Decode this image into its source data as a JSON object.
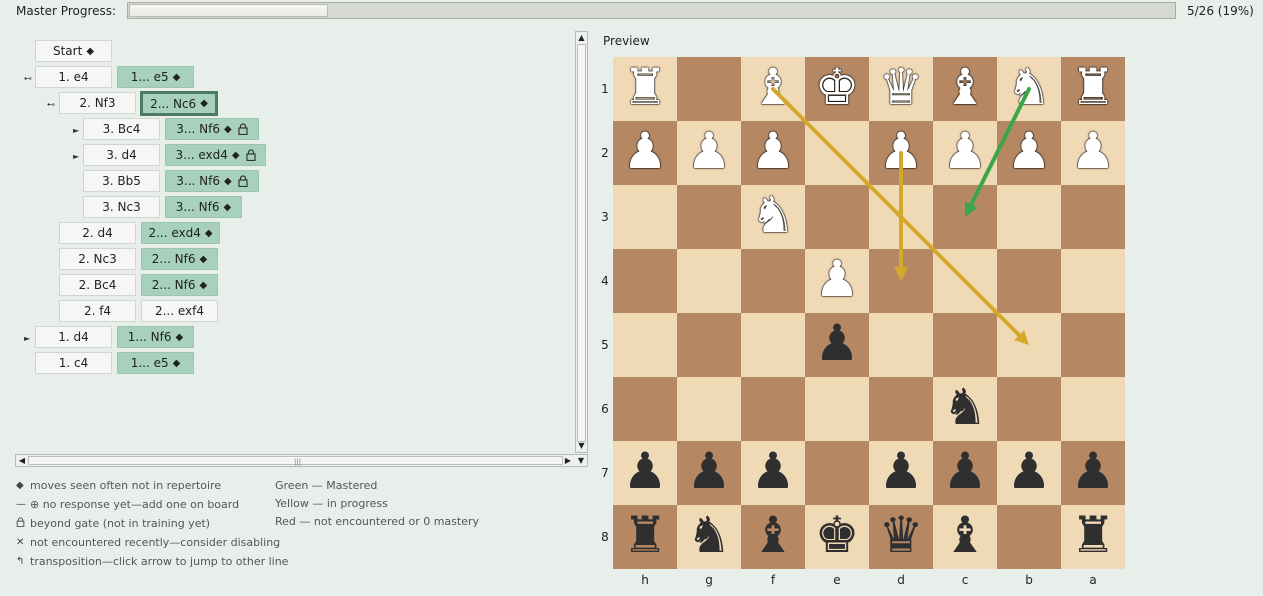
{
  "master_progress": {
    "label": "Master Progress:",
    "value": 0.19,
    "count_text": "5/26 (19%)"
  },
  "tree": {
    "nodes": [
      {
        "id": "start",
        "label": "Start",
        "green": true,
        "diamond": true
      },
      {
        "id": "e4",
        "label": "1. e4"
      },
      {
        "id": "e5",
        "label": "1... e5",
        "green": true,
        "diamond": true
      },
      {
        "id": "nf3",
        "label": "2. Nf3"
      },
      {
        "id": "nc6",
        "label": "2... Nc6",
        "green": true,
        "diamond": true,
        "selected": true
      },
      {
        "id": "bc4",
        "label": "3. Bc4"
      },
      {
        "id": "nf6a",
        "label": "3... Nf6",
        "green": true,
        "diamond": true,
        "lock": true
      },
      {
        "id": "d4",
        "label": "3. d4"
      },
      {
        "id": "exd4a",
        "label": "3... exd4",
        "green": true,
        "diamond": true,
        "lock": true
      },
      {
        "id": "bb5",
        "label": "3. Bb5"
      },
      {
        "id": "nf6b",
        "label": "3... Nf6",
        "green": true,
        "diamond": true,
        "lock": true
      },
      {
        "id": "nc3a",
        "label": "3. Nc3"
      },
      {
        "id": "nf6c",
        "label": "3... Nf6",
        "green": true,
        "diamond": true
      },
      {
        "id": "d4b",
        "label": "2. d4"
      },
      {
        "id": "exd4b",
        "label": "2... exd4",
        "green": true,
        "diamond": true
      },
      {
        "id": "nc3b",
        "label": "2. Nc3"
      },
      {
        "id": "nf6d",
        "label": "2... Nf6",
        "green": true,
        "diamond": true
      },
      {
        "id": "bc4b",
        "label": "2. Bc4"
      },
      {
        "id": "nf6e",
        "label": "2... Nf6",
        "green": true,
        "diamond": true
      },
      {
        "id": "f4",
        "label": "2. f4"
      },
      {
        "id": "exf4",
        "label": "2... exf4"
      },
      {
        "id": "d4c",
        "label": "1. d4"
      },
      {
        "id": "nf6f",
        "label": "1... Nf6",
        "green": true,
        "diamond": true
      },
      {
        "id": "c4",
        "label": "1. c4"
      },
      {
        "id": "e5b",
        "label": "1... e5",
        "green": true,
        "diamond": true
      }
    ]
  },
  "legend": {
    "left": [
      {
        "glyph": "◆",
        "text": "moves seen often not in repertoire"
      },
      {
        "glyph": "—",
        "text": "⊕  no response yet—add one on board"
      },
      {
        "glyph": "🔒",
        "text": "beyond gate (not in training yet)"
      },
      {
        "glyph": "✕",
        "text": "not encountered recently—consider disabling"
      },
      {
        "glyph": "↰",
        "text": "transposition—click arrow to jump to other line"
      }
    ],
    "right": [
      "Green — Mastered",
      "Yellow — in progress",
      "Red — not encountered or 0 mastery"
    ]
  },
  "preview": {
    "title": "Preview",
    "files": [
      "h",
      "g",
      "f",
      "e",
      "d",
      "c",
      "b",
      "a"
    ],
    "ranks": [
      "1",
      "2",
      "3",
      "4",
      "5",
      "6",
      "7",
      "8"
    ],
    "pieces": [
      {
        "sq": "h1",
        "glyph": "♜",
        "color": "w"
      },
      {
        "sq": "f1",
        "glyph": "♝",
        "color": "w"
      },
      {
        "sq": "e1",
        "glyph": "♚",
        "color": "w"
      },
      {
        "sq": "d1",
        "glyph": "♛",
        "color": "w"
      },
      {
        "sq": "c1",
        "glyph": "♝",
        "color": "w"
      },
      {
        "sq": "b1",
        "glyph": "♞",
        "color": "w"
      },
      {
        "sq": "a1",
        "glyph": "♜",
        "color": "w"
      },
      {
        "sq": "h2",
        "glyph": "♟",
        "color": "w"
      },
      {
        "sq": "g2",
        "glyph": "♟",
        "color": "w"
      },
      {
        "sq": "f2",
        "glyph": "♟",
        "color": "w"
      },
      {
        "sq": "d2",
        "glyph": "♟",
        "color": "w"
      },
      {
        "sq": "c2",
        "glyph": "♟",
        "color": "w"
      },
      {
        "sq": "b2",
        "glyph": "♟",
        "color": "w"
      },
      {
        "sq": "a2",
        "glyph": "♟",
        "color": "w"
      },
      {
        "sq": "f3",
        "glyph": "♞",
        "color": "w"
      },
      {
        "sq": "e4",
        "glyph": "♟",
        "color": "w"
      },
      {
        "sq": "e5",
        "glyph": "♟",
        "color": "b"
      },
      {
        "sq": "c6",
        "glyph": "♞",
        "color": "b"
      },
      {
        "sq": "h7",
        "glyph": "♟",
        "color": "b"
      },
      {
        "sq": "g7",
        "glyph": "♟",
        "color": "b"
      },
      {
        "sq": "f7",
        "glyph": "♟",
        "color": "b"
      },
      {
        "sq": "d7",
        "glyph": "♟",
        "color": "b"
      },
      {
        "sq": "c7",
        "glyph": "♟",
        "color": "b"
      },
      {
        "sq": "b7",
        "glyph": "♟",
        "color": "b"
      },
      {
        "sq": "a7",
        "glyph": "♟",
        "color": "b"
      },
      {
        "sq": "h8",
        "glyph": "♜",
        "color": "b"
      },
      {
        "sq": "g8",
        "glyph": "♞",
        "color": "b"
      },
      {
        "sq": "f8",
        "glyph": "♝",
        "color": "b"
      },
      {
        "sq": "e8",
        "glyph": "♚",
        "color": "b"
      },
      {
        "sq": "d8",
        "glyph": "♛",
        "color": "b"
      },
      {
        "sq": "c8",
        "glyph": "♝",
        "color": "b"
      },
      {
        "sq": "a8",
        "glyph": "♜",
        "color": "b"
      }
    ],
    "arrows": [
      {
        "from": "f1",
        "to": "b5",
        "color": "#d4a82a"
      },
      {
        "from": "d2",
        "to": "d4",
        "color": "#d4a82a"
      },
      {
        "from": "b1",
        "to": "c3",
        "color": "#3aa648"
      }
    ],
    "colors": {
      "light": "#f0d9b5",
      "dark": "#b58863"
    }
  }
}
